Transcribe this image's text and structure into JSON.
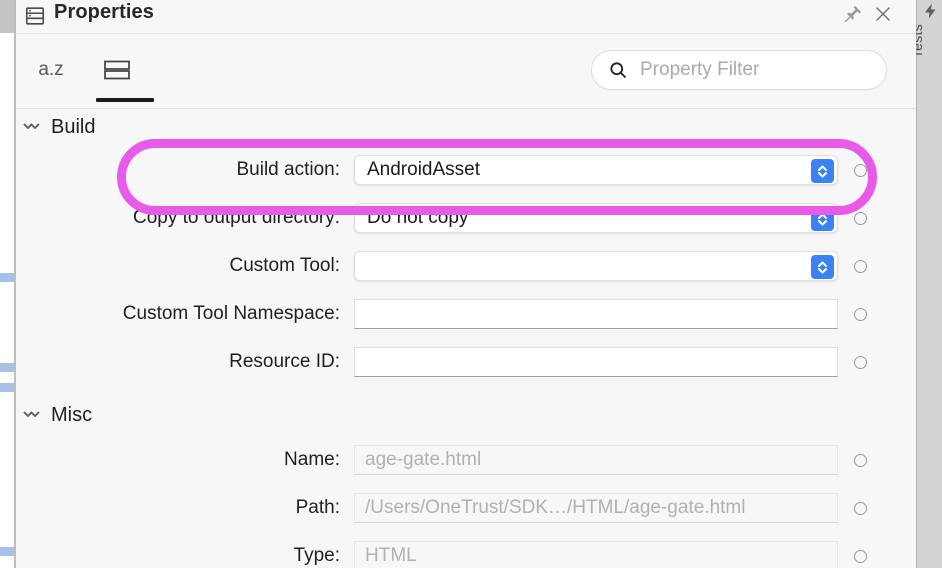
{
  "window": {
    "panel_title": "Properties",
    "title_icon": "properties-list-icon",
    "pin_icon": "pin-icon",
    "close_icon": "close-icon"
  },
  "right_rail": {
    "label": "Tests",
    "icon": "lightning-bolt-icon"
  },
  "toolbar": {
    "tabs": [
      {
        "id": "alphabetical",
        "label": "a.z",
        "icon": "sort-alphabetical-icon",
        "active": false
      },
      {
        "id": "categorized",
        "label": "",
        "icon": "categorized-list-icon",
        "active": true
      }
    ],
    "filter": {
      "icon": "search-icon",
      "placeholder": "Property Filter",
      "value": ""
    }
  },
  "groups": [
    {
      "id": "build",
      "label": "Build",
      "chevron_icon": "chevron-collapse-icon",
      "rows": [
        {
          "id": "build-action",
          "label": "Build action:",
          "control": "combo",
          "value": "AndroidAsset",
          "stepper_icon": "chevron-up-down-icon",
          "dot_icon": "reset-dot-icon",
          "highlighted": true
        },
        {
          "id": "copy-to-output-directory",
          "label": "Copy to output directory:",
          "control": "combo",
          "value": "Do not copy",
          "stepper_icon": "chevron-up-down-icon",
          "dot_icon": "reset-dot-icon",
          "highlighted": false
        },
        {
          "id": "custom-tool",
          "label": "Custom Tool:",
          "control": "combo",
          "value": "",
          "stepper_icon": "chevron-up-down-icon",
          "dot_icon": "reset-dot-icon",
          "highlighted": false
        },
        {
          "id": "custom-tool-namespace",
          "label": "Custom Tool Namespace:",
          "control": "textfield",
          "value": "",
          "dot_icon": "reset-dot-icon",
          "highlighted": false
        },
        {
          "id": "resource-id",
          "label": "Resource ID:",
          "control": "textfield",
          "value": "",
          "dot_icon": "reset-dot-icon",
          "highlighted": false
        }
      ]
    },
    {
      "id": "misc",
      "label": "Misc",
      "chevron_icon": "chevron-collapse-icon",
      "rows": [
        {
          "id": "name",
          "label": "Name:",
          "control": "textfield-readonly",
          "value": "age-gate.html",
          "dot_icon": "reset-dot-icon",
          "highlighted": false
        },
        {
          "id": "path",
          "label": "Path:",
          "control": "textfield-readonly",
          "value": "/Users/OneTrust/SDK…/HTML/age-gate.html",
          "dot_icon": "reset-dot-icon",
          "highlighted": false
        },
        {
          "id": "type",
          "label": "Type:",
          "control": "textfield-readonly",
          "value": "HTML",
          "dot_icon": "reset-dot-icon",
          "highlighted": false
        }
      ]
    }
  ],
  "annotation": {
    "type": "highlight-ring",
    "target": "build-action",
    "color": "#e85ae8"
  }
}
